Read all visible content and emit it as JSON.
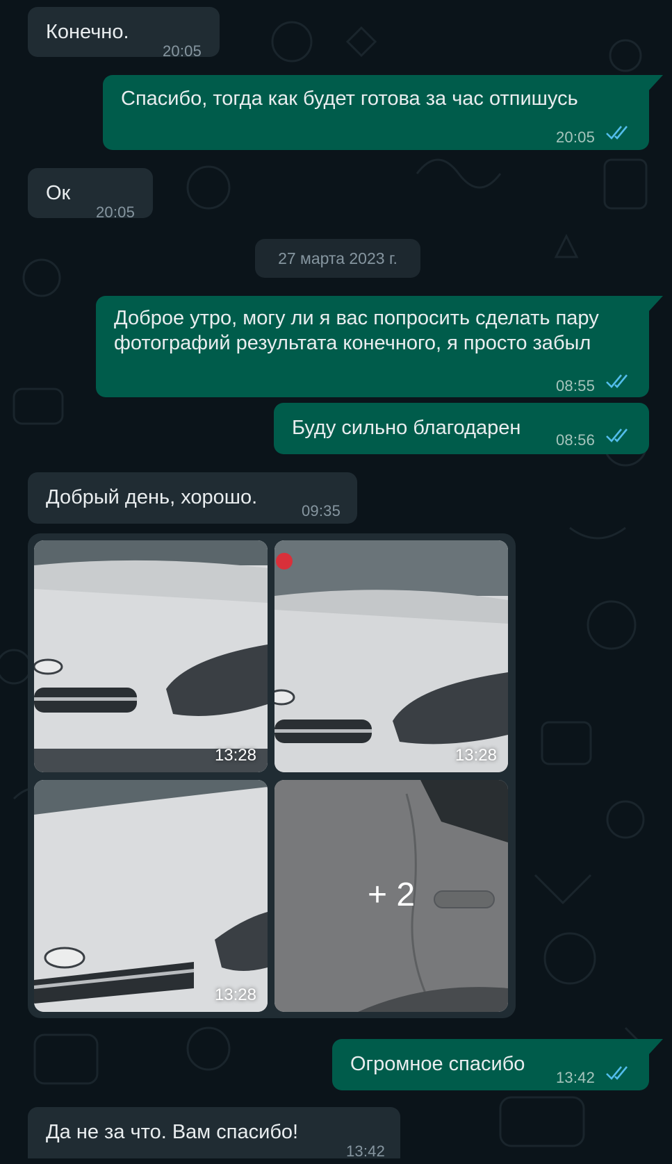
{
  "colors": {
    "background": "#0b141a",
    "incoming_bubble": "#202c33",
    "outgoing_bubble": "#005c4b",
    "read_ticks": "#53bdeb",
    "timestamp": "#8696a0"
  },
  "messages": [
    {
      "direction": "incoming",
      "text": "Конечно.",
      "time": "20:05"
    },
    {
      "direction": "outgoing",
      "text": "Спасибо, тогда как будет готова за час отпишусь",
      "time": "20:05",
      "status_icon": "double-check-icon"
    },
    {
      "direction": "incoming",
      "text": "Ок",
      "time": "20:05"
    },
    {
      "direction": "outgoing",
      "text": "Доброе утро, могу ли я вас попросить сделать пару фотографий результата конечного, я просто забыл",
      "time": "08:55",
      "status_icon": "double-check-icon"
    },
    {
      "direction": "outgoing",
      "text": "Буду сильно благодарен",
      "time": "08:56",
      "status_icon": "double-check-icon"
    },
    {
      "direction": "incoming",
      "text": "Добрый день, хорошо.",
      "time": "09:35"
    },
    {
      "direction": "outgoing",
      "text": "Огромное спасибо",
      "time": "13:42",
      "status_icon": "double-check-icon"
    },
    {
      "direction": "incoming",
      "text": "Да не за что. Вам спасибо!",
      "time": "13:42"
    }
  ],
  "date_separator": "27 марта 2023 г.",
  "album": {
    "photos": [
      {
        "time": "13:28",
        "subject": "white car hood and headlight"
      },
      {
        "time": "13:28",
        "subject": "white car hood and headlight"
      },
      {
        "time": "13:28",
        "subject": "white car hood and grille"
      }
    ],
    "more": {
      "label": "+ 2",
      "subject": "white car side door"
    }
  }
}
